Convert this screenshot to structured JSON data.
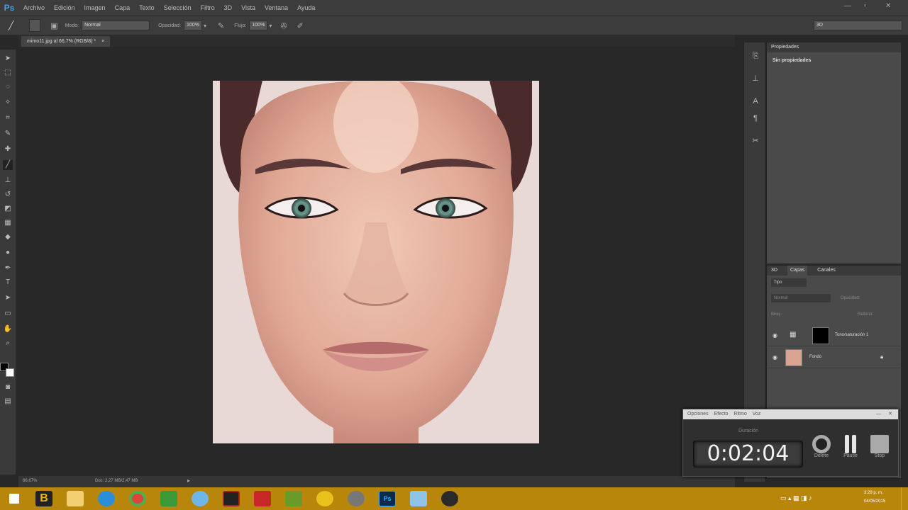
{
  "app": {
    "logo": "Ps"
  },
  "menu": [
    "Archivo",
    "Edición",
    "Imagen",
    "Capa",
    "Texto",
    "Selección",
    "Filtro",
    "3D",
    "Vista",
    "Ventana",
    "Ayuda"
  ],
  "options": {
    "mode_label": "Modo:",
    "mode_value": "Normal",
    "opacity_label": "Opacidad:",
    "opacity_value": "100%",
    "flow_label": "Flujo:",
    "flow_value": "100%",
    "workspace": "3D"
  },
  "document": {
    "tab_title": "mimo11.jpg al 66,7% (RGB/8) *",
    "zoom": "66,67%",
    "doc_info": "Doc: 2,27 MB/2,47 MB"
  },
  "properties": {
    "title": "Propiedades",
    "empty_text": "Sin propiedades"
  },
  "layers": {
    "tabs": [
      "3D",
      "Capas",
      "Canales"
    ],
    "kind_filter": "Tipo",
    "blend_mode": "Normal",
    "opacity_label": "Opacidad:",
    "lock_label": "Bloq.:",
    "fill_label": "Relleno:",
    "items": [
      {
        "name": "Tono/saturación 1"
      },
      {
        "name": "Fondo"
      }
    ]
  },
  "timer": {
    "menu": [
      "Opciones",
      "Efecto",
      "Ritmo",
      "Voz"
    ],
    "label": "Duración",
    "time": "0:02:04",
    "buttons": [
      "Delete",
      "Pause",
      "Stop"
    ]
  },
  "tray": {
    "time": "3:29 p. m.",
    "date": "04/05/2015"
  },
  "colors": {
    "accent": "#31a8ff",
    "taskbar": "#b8860b"
  }
}
